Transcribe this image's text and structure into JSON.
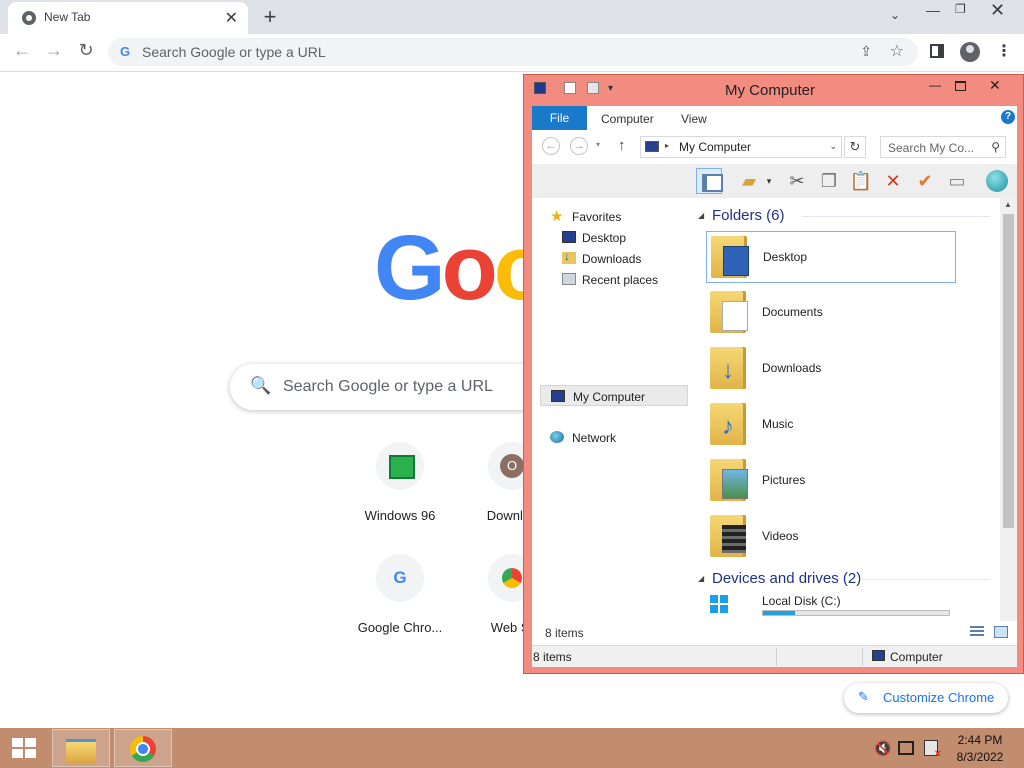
{
  "browser": {
    "tab_title": "New Tab",
    "tab_close": "✕",
    "new_tab": "+",
    "tab_search": "⌄",
    "window_min": "—",
    "window_max": "❐",
    "window_close": "✕",
    "back": "←",
    "forward": "→",
    "reload": "↻",
    "omnibox_g": "G",
    "omnibox_placeholder": "Search Google or type a URL",
    "share": "⇪",
    "star": "☆",
    "menu": "⋮"
  },
  "ntp": {
    "logo": [
      "G",
      "o",
      "o"
    ],
    "search_icon": "🔍",
    "search_placeholder": "Search Google or type a URL",
    "shortcuts": [
      {
        "label": "Windows 96"
      },
      {
        "label": "Downloa"
      },
      {
        "label": "Google Chro..."
      },
      {
        "label": "Web St"
      }
    ],
    "customize_icon": "✎",
    "customize_label": "Customize Chrome"
  },
  "explorer": {
    "title": "My Computer",
    "quick_access_drop": "▾",
    "controls": {
      "min": "—",
      "close": "✕"
    },
    "ribbon": {
      "file": "File",
      "tabs": [
        "Computer",
        "View"
      ],
      "help": "?"
    },
    "address": {
      "back": "←",
      "forward": "→",
      "history": "▾",
      "up": "↑",
      "separator": "▸",
      "path": "My Computer",
      "chevron": "⌄",
      "refresh": "↻",
      "search_placeholder": "Search My Co...",
      "search_icon": "⚲"
    },
    "toolbar": {
      "dropdown": "▾",
      "cut": "✂",
      "copy": "❐",
      "paste": "📋",
      "delete": "✕",
      "check": "✔",
      "props": "▭"
    },
    "nav_pane": {
      "favorites": "Favorites",
      "favorites_icon": "★",
      "desktop": "Desktop",
      "downloads": "Downloads",
      "recent": "Recent places",
      "computer": "My Computer",
      "network": "Network"
    },
    "groups": {
      "folders_arrow": "◢",
      "folders": "Folders (6)",
      "devices_arrow": "◢",
      "devices": "Devices and drives (2)"
    },
    "folders": [
      {
        "label": "Desktop"
      },
      {
        "label": "Documents"
      },
      {
        "label": "Downloads"
      },
      {
        "label": "Music"
      },
      {
        "label": "Pictures"
      },
      {
        "label": "Videos"
      }
    ],
    "drive": {
      "label": "Local Disk (C:)",
      "used_fraction": 0.17
    },
    "scroll": {
      "up": "▲",
      "down": "▼"
    },
    "item_count": "8 items",
    "statusbar": {
      "count": "8 items",
      "location": "Computer"
    }
  },
  "taskbar": {
    "volume_icon": "🔇",
    "time": "2:44 PM",
    "date": "8/3/2022"
  }
}
